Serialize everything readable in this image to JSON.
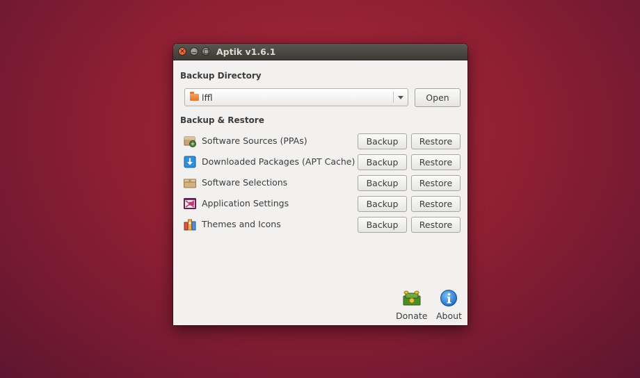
{
  "window": {
    "title": "Aptik v1.6.1"
  },
  "backup_directory": {
    "heading": "Backup Directory",
    "selected": "lffl",
    "open_label": "Open"
  },
  "backup_restore": {
    "heading": "Backup & Restore",
    "backup_label": "Backup",
    "restore_label": "Restore",
    "items": [
      {
        "label": "Software Sources (PPAs)",
        "icon": "software-sources-icon"
      },
      {
        "label": "Downloaded Packages (APT Cache)",
        "icon": "download-icon"
      },
      {
        "label": "Software Selections",
        "icon": "package-box-icon"
      },
      {
        "label": "Application Settings",
        "icon": "app-settings-icon"
      },
      {
        "label": "Themes and Icons",
        "icon": "themes-icon"
      }
    ]
  },
  "footer": {
    "donate_label": "Donate",
    "about_label": "About"
  }
}
